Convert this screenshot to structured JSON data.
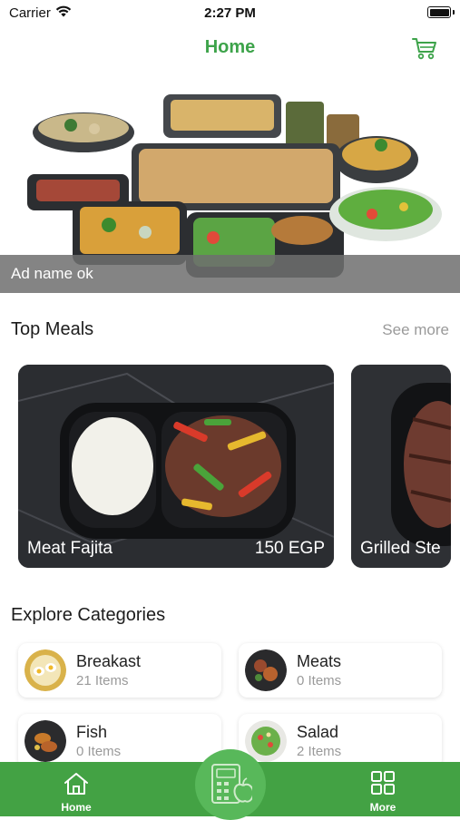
{
  "status_bar": {
    "carrier": "Carrier",
    "time": "2:27 PM"
  },
  "nav": {
    "title": "Home",
    "cart_icon": "cart-icon"
  },
  "banner": {
    "caption": "Ad name ok"
  },
  "top_meals": {
    "title": "Top Meals",
    "see_more": "See more",
    "items": [
      {
        "name": "Meat Fajita",
        "price": "150 EGP"
      },
      {
        "name": "Grilled Ste",
        "price": ""
      }
    ]
  },
  "categories": {
    "title": "Explore Categories",
    "items": [
      {
        "name": "Breakast",
        "count": "21 Items"
      },
      {
        "name": "Meats",
        "count": "0 Items"
      },
      {
        "name": "Fish",
        "count": "0 Items"
      },
      {
        "name": "Salad",
        "count": "2 Items"
      }
    ]
  },
  "tab_bar": {
    "home_label": "Home",
    "more_label": "More",
    "center_icon": "calorie-calculator-icon"
  },
  "colors": {
    "accent": "#3da34a",
    "tab_bar": "#43a244"
  }
}
